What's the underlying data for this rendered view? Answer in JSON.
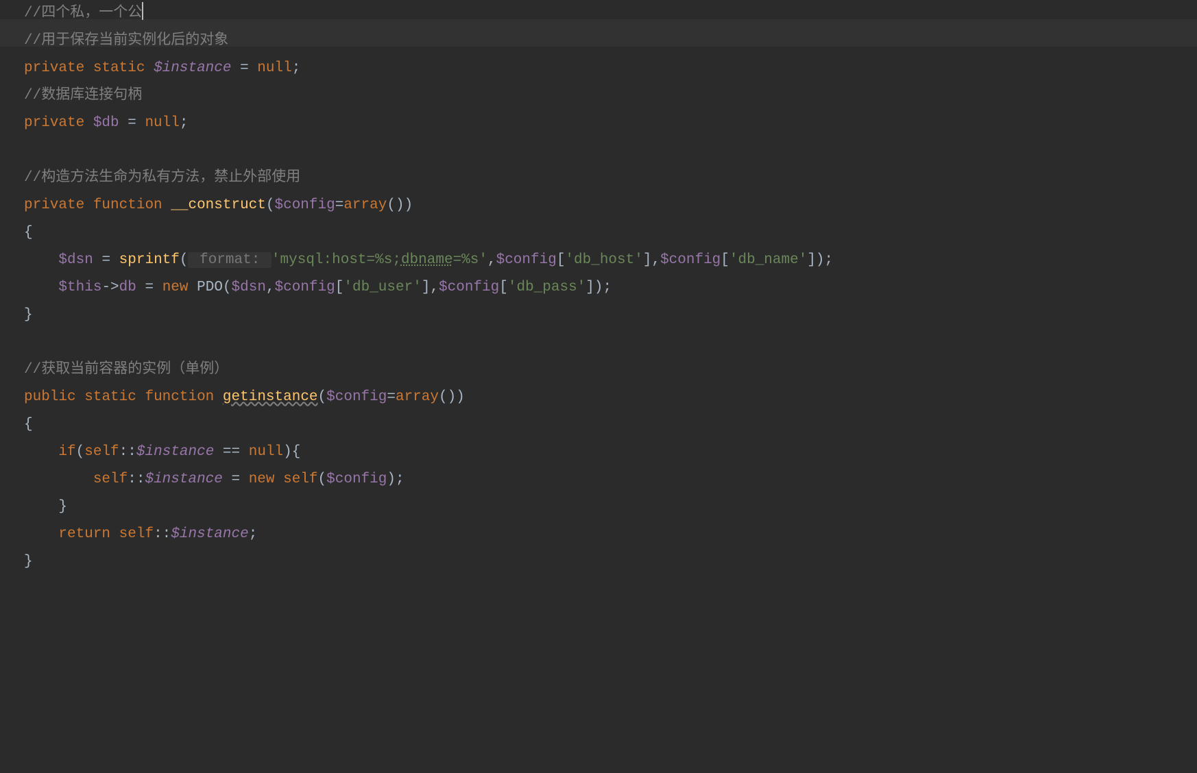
{
  "lines": {
    "l1_comment": "//四个私，一个公",
    "l2_comment": "//用于保存当前实例化后的对象",
    "l3": {
      "private": "private",
      "static": "static",
      "var": "$instance",
      "assign": " = ",
      "null": "null",
      "semi": ";"
    },
    "l4_comment": "//数据库连接句柄",
    "l5": {
      "private": "private",
      "var": "$db",
      "assign": " = ",
      "null": "null",
      "semi": ";"
    },
    "l7_comment": "//构造方法生命为私有方法，禁止外部使用",
    "l8": {
      "private": "private",
      "function": "function",
      "name": "__construct",
      "open": "(",
      "param": "$config",
      "eq": "=",
      "array": "array",
      "parens": "()",
      "close": ")"
    },
    "l9_brace": "{",
    "l10": {
      "var": "$dsn",
      "assign": " = ",
      "func": "sprintf",
      "open": "(",
      "hint": " format: ",
      "str1": "'mysql:host=%s;",
      "str_underline": "dbname",
      "str2": "=%s'",
      "comma1": ",",
      "config1": "$config",
      "bracket1": "[",
      "key1": "'db_host'",
      "bracket1c": "]",
      "comma2": ",",
      "config2": "$config",
      "bracket2": "[",
      "key2": "'db_name'",
      "bracket2c": "])",
      "semi": ";"
    },
    "l11": {
      "this": "$this",
      "arrow": "->",
      "prop": "db",
      "assign": " = ",
      "new": "new",
      "class": "PDO",
      "open": "(",
      "dsn": "$dsn",
      "comma1": ",",
      "config1": "$config",
      "bracket1": "[",
      "key1": "'db_user'",
      "bracket1c": "]",
      "comma2": ",",
      "config2": "$config",
      "bracket2": "[",
      "key2": "'db_pass'",
      "bracket2c": "])",
      "semi": ";"
    },
    "l12_brace": "}",
    "l14_comment": "//获取当前容器的实例（单例）",
    "l15": {
      "public": "public",
      "static": "static",
      "function": "function",
      "name": "getinstance",
      "open": "(",
      "param": "$config",
      "eq": "=",
      "array": "array",
      "parens": "()",
      "close": ")"
    },
    "l16_brace": "{",
    "l17": {
      "if": "if",
      "open": "(",
      "self": "self",
      "scope": "::",
      "var": "$instance",
      "eqeq": " == ",
      "null": "null",
      "close": ")",
      "brace": "{"
    },
    "l18": {
      "self": "self",
      "scope": "::",
      "var": "$instance",
      "assign": " = ",
      "new": "new",
      "selfclass": "self",
      "open": "(",
      "param": "$config",
      "close": ")",
      "semi": ";"
    },
    "l19_brace": "}",
    "l20": {
      "return": "return",
      "self": "self",
      "scope": "::",
      "var": "$instance",
      "semi": ";"
    },
    "l21_brace": "}"
  }
}
